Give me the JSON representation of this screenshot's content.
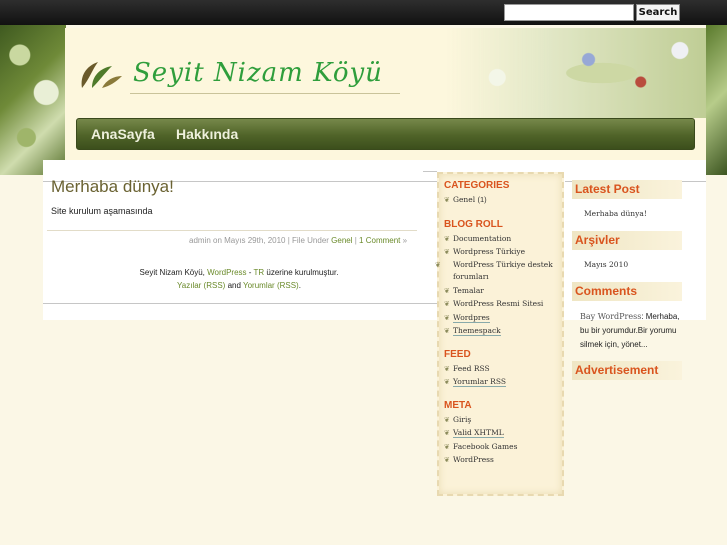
{
  "topbar": {
    "search_placeholder": "",
    "search_button": "Search"
  },
  "header": {
    "site_title": "Seyit Nizam Köyü"
  },
  "nav": {
    "items": [
      "AnaSayfa",
      "Hakkında"
    ]
  },
  "post": {
    "title": "Merhaba dünya!",
    "body": "Site kurulum aşamasında",
    "meta_prefix": "admin on Mayıs 29th, 2010 | File Under ",
    "meta_category": "Genel",
    "meta_sep": " | ",
    "meta_comments": "1 Comment",
    "meta_suffix": " »"
  },
  "footer": {
    "prefix": "Seyit Nizam Köyü, ",
    "wordpress": "WordPress",
    "dash": " - ",
    "tr": "TR",
    "suffix": " üzerine kurulmuştur.",
    "posts_rss": "Yazılar (RSS)",
    "and": " and ",
    "comments_rss": "Yorumlar (RSS)",
    "period": "."
  },
  "sidebar": {
    "categories": {
      "heading": "CATEGORIES",
      "items": [
        {
          "label": "Genel",
          "count": "(1)"
        }
      ]
    },
    "blogroll": {
      "heading": "BLOG ROLL",
      "items": [
        "Documentation",
        "Wordpress Türkiye",
        "WordPress Türkiye destek forumları",
        "Temalar",
        "WordPress Resmi Sitesi",
        "Wordpres",
        "Themespack"
      ]
    },
    "feed": {
      "heading": "FEED",
      "items": [
        "Feed RSS",
        "Yorumlar RSS"
      ]
    },
    "meta": {
      "heading": "META",
      "items": [
        "Giriş",
        "Valid XHTML",
        "Facebook Games",
        "WordPress"
      ]
    }
  },
  "right_sidebar": {
    "latest_post": {
      "heading": "Latest Post",
      "item": "Merhaba dünya!"
    },
    "archives": {
      "heading": "Arşivler",
      "item": "Mayıs 2010"
    },
    "comments": {
      "heading": "Comments",
      "author": "Bay WordPress",
      "text": ": Merhaba, bu bir yorumdur.Bir yorumu silmek için, yönet..."
    },
    "advertisement": {
      "heading": "Advertisement"
    }
  },
  "colors": {
    "accent_heading": "#d9541e",
    "nav_green": "#4f6328",
    "title_green": "#2f9e3c",
    "link_green": "#6a8a2a"
  }
}
